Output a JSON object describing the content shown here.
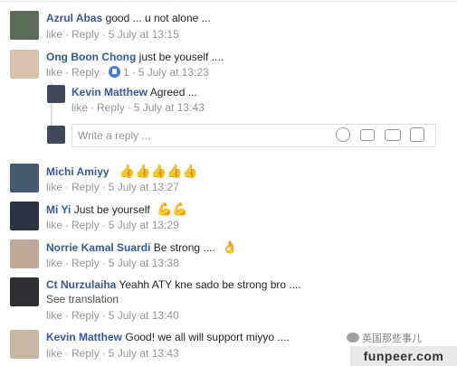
{
  "comments": [
    {
      "name": "Azrul Abas",
      "text": "good ... u not alone ...",
      "like": "like",
      "reply": "Reply",
      "time": "5 July at 13:15"
    },
    {
      "name": "Ong Boon Chong",
      "text": "just be youself ....",
      "like": "like",
      "reply": "Reply",
      "likes_count": "1",
      "time": "5 July at 13:23"
    },
    {
      "name": "Michi Amiyy",
      "text": "",
      "like": "like",
      "reply": "Reply",
      "time": "5 July at 13:27"
    },
    {
      "name": "Mi Yi",
      "text": "Just be yourself",
      "like": "like",
      "reply": "Reply",
      "time": "5 July at 13:29"
    },
    {
      "name": "Norrie Kamal Suardi",
      "text": "Be strong ....",
      "like": "like",
      "reply": "Reply",
      "time": "5 July at 13:38"
    },
    {
      "name": "Ct Nurzulaiha",
      "text": "Yeahh ATY kne sado be strong bro ....",
      "see_translation": "See translation",
      "like": "like",
      "reply": "Reply",
      "time": "5 July at 13:40"
    },
    {
      "name": "Kevin Matthew",
      "text": "Good! we all will support miyyo ....",
      "like": "like",
      "reply": "Reply",
      "time": "5 July at 13:43"
    }
  ],
  "reply": {
    "name": "Kevin Matthew",
    "text": "Agreed ...",
    "like": "like",
    "reply": "Reply",
    "time": "5 July at 13:43"
  },
  "reply_box": {
    "placeholder": "Write a reply ..."
  },
  "watermark": {
    "domain": "funpeer.com",
    "wechat": "英国那些事儿"
  }
}
